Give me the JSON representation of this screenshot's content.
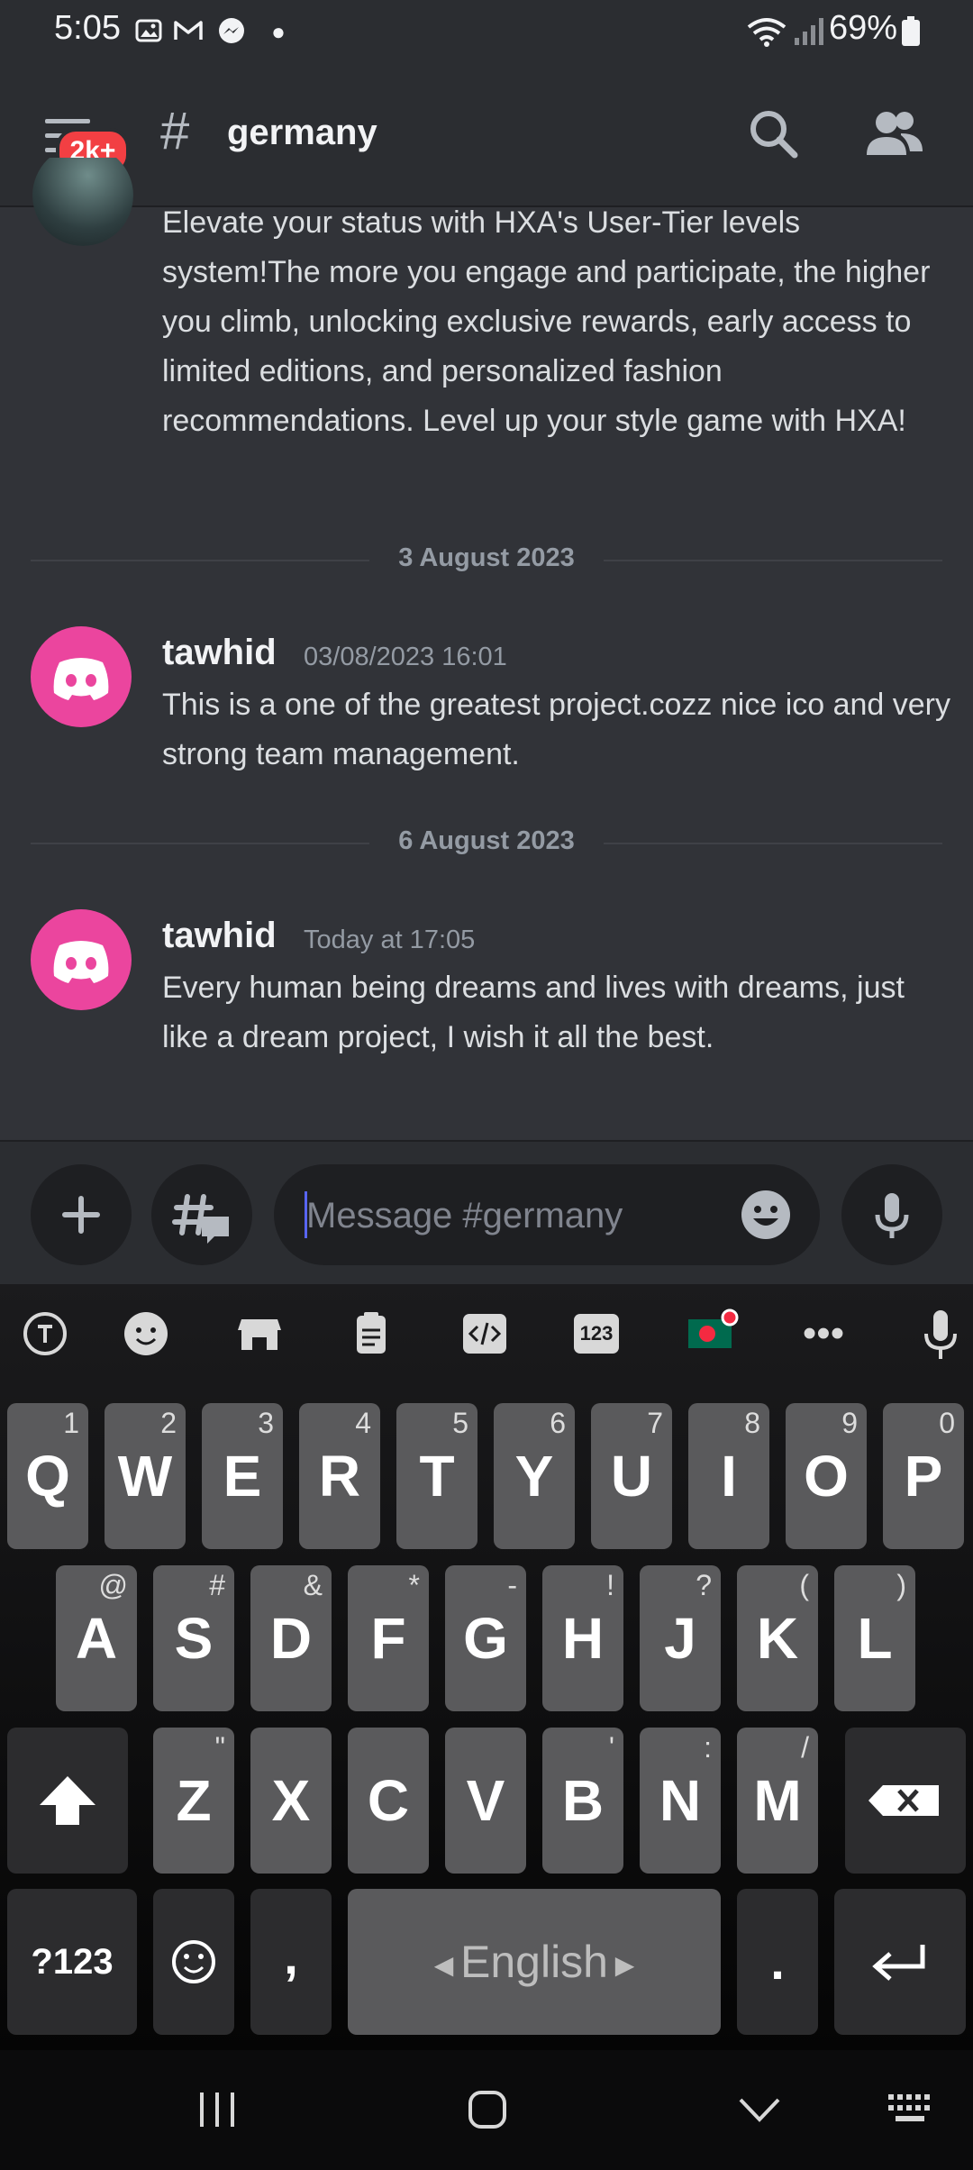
{
  "status_bar": {
    "time": "5:05",
    "battery": "69%"
  },
  "header": {
    "badge": "2k+",
    "hash": "#",
    "channel_name": "germany"
  },
  "messages": [
    {
      "text": "Elevate your status with HXA's User-Tier levels system!The more you engage and participate, the higher you climb, unlocking exclusive rewards, early access to limited editions, and personalized fashion recommendations. Level up your style game with HXA!"
    },
    {
      "date_divider": "3 August 2023",
      "username": "tawhid",
      "timestamp": "03/08/2023 16:01",
      "text": "This is a one of the greatest project.cozz nice ico and very strong team management."
    },
    {
      "date_divider": "6 August 2023",
      "username": "tawhid",
      "timestamp": "Today at 17:05",
      "text": "Every human being dreams and lives with dreams, just like a dream project, I wish it all the best."
    }
  ],
  "composer": {
    "placeholder": "Message #germany"
  },
  "keyboard": {
    "toolbar_text_123": "123",
    "row1": [
      {
        "k": "Q",
        "h": "1"
      },
      {
        "k": "W",
        "h": "2"
      },
      {
        "k": "E",
        "h": "3"
      },
      {
        "k": "R",
        "h": "4"
      },
      {
        "k": "T",
        "h": "5"
      },
      {
        "k": "Y",
        "h": "6"
      },
      {
        "k": "U",
        "h": "7"
      },
      {
        "k": "I",
        "h": "8"
      },
      {
        "k": "O",
        "h": "9"
      },
      {
        "k": "P",
        "h": "0"
      }
    ],
    "row2": [
      {
        "k": "A",
        "h": "@"
      },
      {
        "k": "S",
        "h": "#"
      },
      {
        "k": "D",
        "h": "&"
      },
      {
        "k": "F",
        "h": "*"
      },
      {
        "k": "G",
        "h": "-"
      },
      {
        "k": "H",
        "h": "!"
      },
      {
        "k": "J",
        "h": "?"
      },
      {
        "k": "K",
        "h": "("
      },
      {
        "k": "L",
        "h": ")"
      }
    ],
    "row3": [
      {
        "k": "Z",
        "h": "\""
      },
      {
        "k": "X",
        "h": ""
      },
      {
        "k": "C",
        "h": ""
      },
      {
        "k": "V",
        "h": ""
      },
      {
        "k": "B",
        "h": "'"
      },
      {
        "k": "N",
        "h": ":"
      },
      {
        "k": "M",
        "h": "/"
      }
    ],
    "sym_label": "?123",
    "comma": ",",
    "space_label": "English",
    "period": "."
  }
}
